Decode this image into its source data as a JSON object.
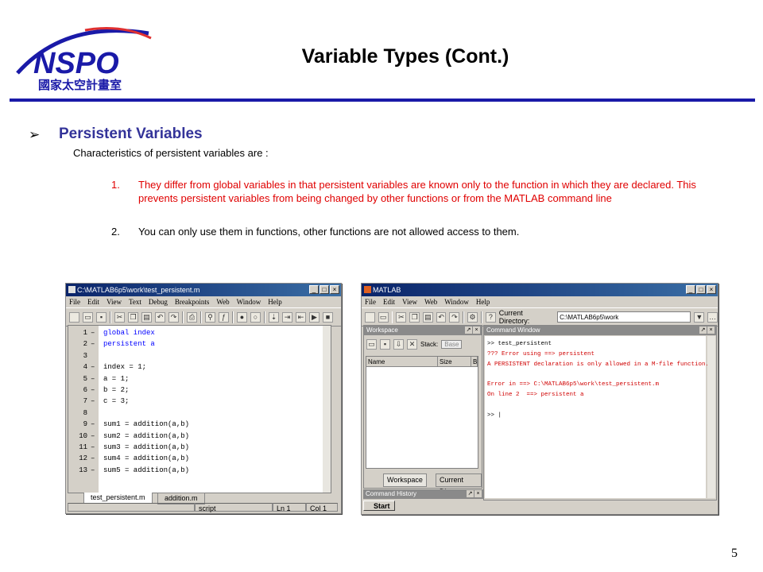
{
  "slide": {
    "title": "Variable Types (Cont.)",
    "logo_text": "NSPO",
    "logo_sub": "國家太空計畫室",
    "page_number": "5",
    "bullet_heading": "Persistent Variables",
    "intro": "Characteristics of persistent variables are :",
    "items": [
      {
        "num": "1.",
        "text": "They differ from global variables in  that persistent variables are known only to the function in which they are declared. This prevents persistent variables from being changed by other functions or from the MATLAB command line",
        "color": "#e00000"
      },
      {
        "num": "2.",
        "text": "You can only use them in functions, other functions are not allowed access to them.",
        "color": "#000000"
      }
    ]
  },
  "editor": {
    "title": "C:\\MATLAB6p5\\work\\test_persistent.m",
    "menu": [
      "File",
      "Edit",
      "View",
      "Text",
      "Debug",
      "Breakpoints",
      "Web",
      "Window",
      "Help"
    ],
    "lines": [
      {
        "n": "1",
        "dash": "–",
        "code": "global index",
        "kw": true
      },
      {
        "n": "2",
        "dash": "–",
        "code": "persistent a",
        "kw": true
      },
      {
        "n": "3",
        "dash": "",
        "code": "",
        "kw": false
      },
      {
        "n": "4",
        "dash": "–",
        "code": "index = 1;",
        "kw": false
      },
      {
        "n": "5",
        "dash": "–",
        "code": "a = 1;",
        "kw": false
      },
      {
        "n": "6",
        "dash": "–",
        "code": "b = 2;",
        "kw": false
      },
      {
        "n": "7",
        "dash": "–",
        "code": "c = 3;",
        "kw": false
      },
      {
        "n": "8",
        "dash": "",
        "code": "",
        "kw": false
      },
      {
        "n": "9",
        "dash": "–",
        "code": "sum1 = addition(a,b)",
        "kw": false
      },
      {
        "n": "10",
        "dash": "–",
        "code": "sum2 = addition(a,b)",
        "kw": false
      },
      {
        "n": "11",
        "dash": "–",
        "code": "sum3 = addition(a,b)",
        "kw": false
      },
      {
        "n": "12",
        "dash": "–",
        "code": "sum4 = addition(a,b)",
        "kw": false
      },
      {
        "n": "13",
        "dash": "–",
        "code": "sum5 = addition(a,b)",
        "kw": false
      }
    ],
    "tabs": [
      "test_persistent.m",
      "addition.m"
    ],
    "status": {
      "mode": "script",
      "ln": "Ln 1",
      "col": "Col 1"
    }
  },
  "matlab": {
    "title": "MATLAB",
    "menu": [
      "File",
      "Edit",
      "View",
      "Web",
      "Window",
      "Help"
    ],
    "current_dir_label": "Current Directory:",
    "current_dir": "C:\\MATLAB6p5\\work",
    "workspace": {
      "title": "Workspace",
      "stack_label": "Stack:",
      "stack_value": "Base",
      "columns": [
        "Name",
        "Size",
        "B"
      ],
      "tabs": [
        "Workspace",
        "Current Direc"
      ]
    },
    "history_title": "Command History",
    "start_label": "Start",
    "command_window": {
      "title": "Command Window",
      "lines": [
        {
          "text": ">> test_persistent",
          "red": false
        },
        {
          "text": "??? Error using ==> persistent",
          "red": true
        },
        {
          "text": "A PERSISTENT declaration is only allowed in a M-file function.",
          "red": true
        },
        {
          "text": "",
          "red": false
        },
        {
          "text": "Error in ==> C:\\MATLAB6p5\\work\\test_persistent.m",
          "red": true
        },
        {
          "text": "On line 2  ==> persistent a",
          "red": true
        },
        {
          "text": "",
          "red": false
        },
        {
          "text": ">> |",
          "red": false
        }
      ]
    }
  }
}
